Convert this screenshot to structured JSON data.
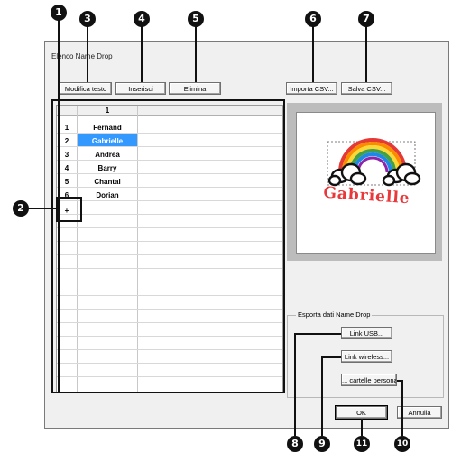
{
  "window": {
    "title": "Elenco Name Drop"
  },
  "toolbar": {
    "edit_text": "Modifica testo",
    "insert": "Inserisci",
    "delete": "Elimina",
    "import_csv": "Importa CSV...",
    "save_csv": "Salva CSV..."
  },
  "grid": {
    "column_header": "1",
    "rows": [
      {
        "num": "1",
        "name": "Fernand"
      },
      {
        "num": "2",
        "name": "Gabrielle"
      },
      {
        "num": "3",
        "name": "Andrea"
      },
      {
        "num": "4",
        "name": "Barry"
      },
      {
        "num": "5",
        "name": "Chantal"
      },
      {
        "num": "6",
        "name": "Dorian"
      }
    ],
    "new_row_marker": "+"
  },
  "preview": {
    "embroidery_text": "Gabrielle"
  },
  "export": {
    "group_label": "Esporta dati Name Drop",
    "usb": "Link USB...",
    "wireless": "Link wireless...",
    "folders": "... cartelle personali"
  },
  "footer": {
    "ok": "OK",
    "cancel": "Annulla"
  },
  "callouts": {
    "c1": "1",
    "c2": "2",
    "c3": "3",
    "c4": "4",
    "c5": "5",
    "c6": "6",
    "c7": "7",
    "c8": "8",
    "c9": "9",
    "c10": "10",
    "c11": "11"
  },
  "colors": {
    "selection": "#3399ff",
    "callout": "#111111",
    "dialog_bg": "#f0f0f0",
    "text_red": "#e8383a"
  }
}
